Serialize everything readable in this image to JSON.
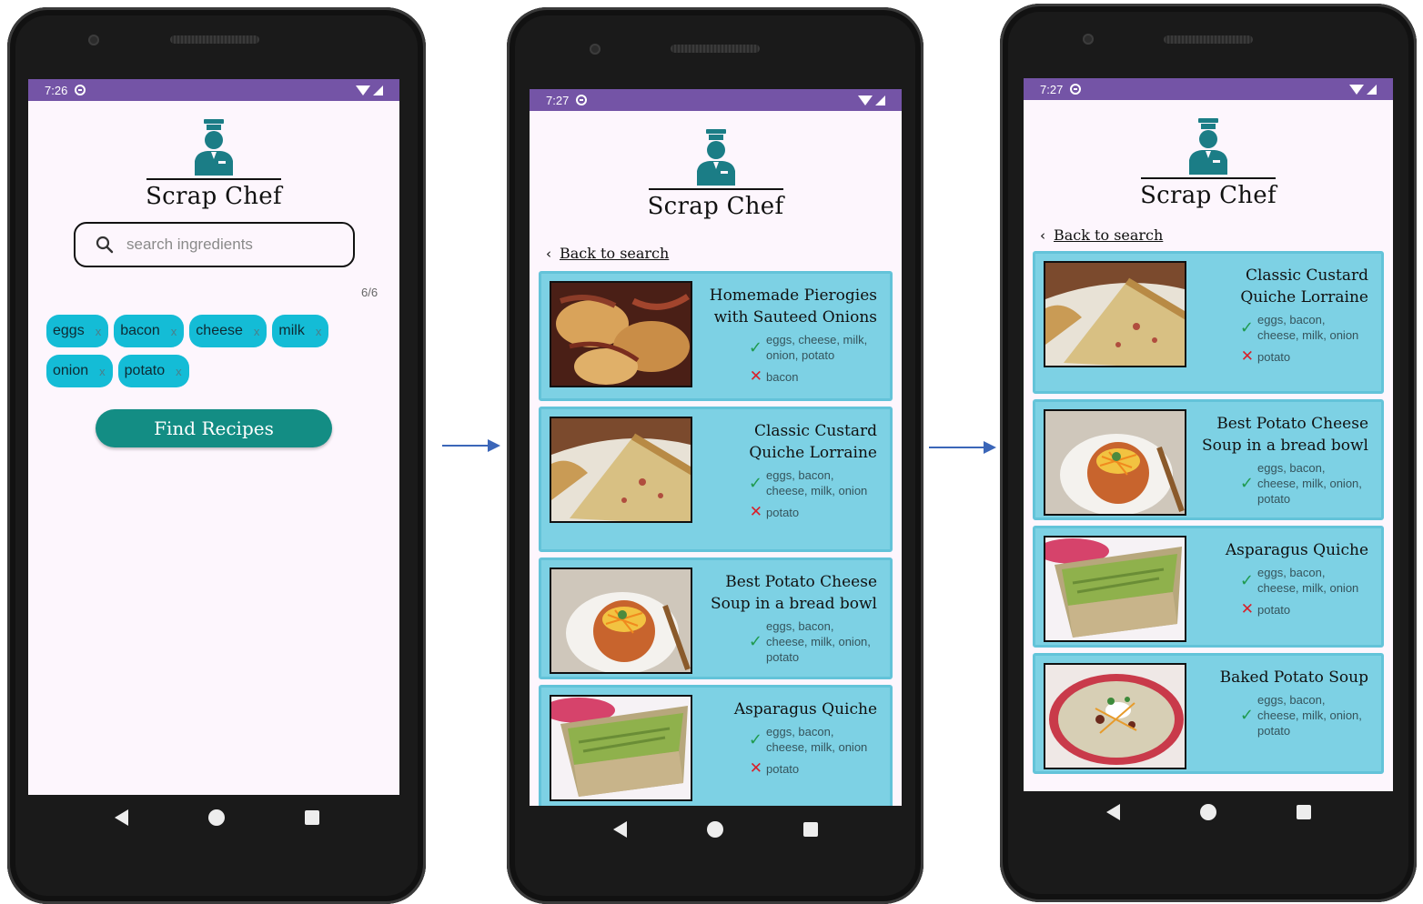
{
  "app": {
    "title": "Scrap Chef",
    "accent_color": "#7454a6",
    "button_color": "#138d84",
    "chip_color": "#14bcd6",
    "card_color": "#7dd1e4"
  },
  "screens": [
    {
      "status": {
        "time": "7:26"
      },
      "search": {
        "placeholder": "search ingredients",
        "counter": "6/6"
      },
      "chips": [
        {
          "label": "eggs",
          "remove": "x"
        },
        {
          "label": "bacon",
          "remove": "x"
        },
        {
          "label": "cheese",
          "remove": "x"
        },
        {
          "label": "milk",
          "remove": "x"
        },
        {
          "label": "onion",
          "remove": "x"
        },
        {
          "label": "potato",
          "remove": "x"
        }
      ],
      "button": "Find Recipes"
    },
    {
      "status": {
        "time": "7:27"
      },
      "back_label": "Back to search",
      "recipes": [
        {
          "title": "Homemade Pierogies with Sauteed Onions",
          "have": "eggs, cheese, milk, onion, potato",
          "missing": "bacon",
          "image": "pierogi"
        },
        {
          "title": "Classic Custard Quiche Lorraine",
          "have": "eggs, bacon, cheese, milk, onion",
          "missing": "potato",
          "image": "quiche"
        },
        {
          "title": "Best Potato Cheese Soup in a bread bowl",
          "have": "eggs, bacon, cheese, milk, onion, potato",
          "missing": "",
          "image": "soup"
        },
        {
          "title": "Asparagus Quiche",
          "have": "eggs, bacon, cheese, milk, onion",
          "missing": "potato",
          "image": "asparagus"
        }
      ]
    },
    {
      "status": {
        "time": "7:27"
      },
      "back_label": "Back to search",
      "recipes": [
        {
          "title": "Classic Custard Quiche Lorraine",
          "have": "eggs, bacon, cheese, milk, onion",
          "missing": "potato",
          "image": "quiche"
        },
        {
          "title": "Best Potato Cheese Soup in a bread bowl",
          "have": "eggs, bacon, cheese, milk, onion, potato",
          "missing": "",
          "image": "soup"
        },
        {
          "title": "Asparagus Quiche",
          "have": "eggs, bacon, cheese, milk, onion",
          "missing": "potato",
          "image": "asparagus"
        },
        {
          "title": "Baked Potato Soup",
          "have": "eggs, bacon, cheese, milk, onion, potato",
          "missing": "",
          "image": "baked"
        }
      ]
    }
  ],
  "icons": {
    "search": "search-icon",
    "chef": "chef-icon",
    "check": "check-icon",
    "cross": "cross-icon",
    "back": "chevron-left-icon"
  }
}
